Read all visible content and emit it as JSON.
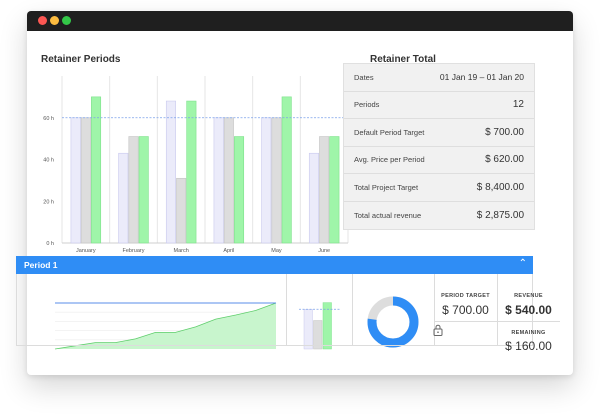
{
  "window": {
    "controls": [
      "close",
      "minimize",
      "maximize"
    ]
  },
  "retainer_periods": {
    "title": "Retainer Periods"
  },
  "chart_data": {
    "type": "bar",
    "categories": [
      "January",
      "February",
      "March",
      "April",
      "May",
      "June"
    ],
    "y_ticks": [
      "0 h",
      "20 h",
      "40 h",
      "60 h"
    ],
    "ylim": [
      0,
      80
    ],
    "target_line": 60,
    "series": [
      {
        "values": [
          60,
          43,
          68,
          60,
          60,
          43
        ],
        "color": "#ebebfa"
      },
      {
        "values": [
          60,
          51,
          31,
          60,
          60,
          51
        ],
        "color": "#dddddd"
      },
      {
        "values": [
          70,
          51,
          68,
          51,
          70,
          51
        ],
        "color": "#9ff5a9"
      }
    ],
    "colors": {
      "target_line": "#7aa0ea",
      "grid": "#e6e6e6"
    }
  },
  "retainer_total": {
    "title": "Retainer Total",
    "rows": [
      {
        "label": "Dates",
        "value": "01 Jan 19  –  01 Jan 20"
      },
      {
        "label": "Periods",
        "value": "12"
      },
      {
        "label": "Default Period Target",
        "value": "$ 700.00"
      },
      {
        "label": "Avg. Price per Period",
        "value": "$ 620.00"
      },
      {
        "label": "Total Project Target",
        "value": "$ 8,400.00"
      },
      {
        "label": "Total actual revenue",
        "value": "$ 2,875.00"
      }
    ]
  },
  "period": {
    "title": "Period 1",
    "collapse_icon": "chevron-up-icon",
    "progress_chart": {
      "target": 100,
      "actual": [
        0,
        7,
        14,
        14,
        22,
        36,
        36,
        48,
        65,
        74,
        84,
        100
      ]
    },
    "mini_bars": {
      "values": [
        60,
        43,
        70
      ],
      "target": 60
    },
    "donut": {
      "fraction": 0.77,
      "color": "#2f8df5",
      "track": "#dddddd"
    },
    "stats": {
      "target_label": "PERIOD TARGET",
      "target_value": "$ 700.00",
      "revenue_label": "REVENUE",
      "revenue_value": "$ 540.00",
      "remaining_label": "REMAINING",
      "remaining_value": "$ 160.00",
      "lock_icon": "lock-icon"
    }
  }
}
